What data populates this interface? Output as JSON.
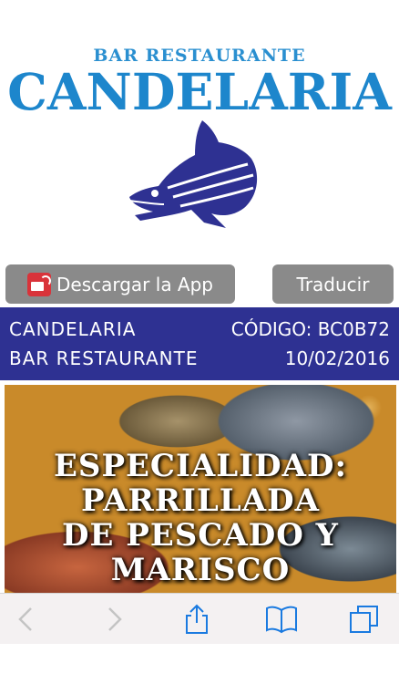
{
  "logo": {
    "subtitle": "BAR RESTAURANTE",
    "title": "CANDELARIA",
    "brand_color": "#1d86cc",
    "fish_color": "#2e3192"
  },
  "buttons": {
    "app_label": "Descargar la App",
    "translate_label": "Traducir"
  },
  "info_bar": {
    "name": "CANDELARIA",
    "type": "BAR RESTAURANTE",
    "code": "CÓDIGO: BC0B72",
    "date": "10/02/2016",
    "bg_color": "#2e3192"
  },
  "banner": {
    "line1": "ESPECIALIDAD:",
    "line2": "PARRILLADA",
    "line3": "DE PESCADO Y",
    "line4": "MARISCO"
  },
  "toolbar": {
    "icons": [
      "back-icon",
      "forward-icon",
      "share-icon",
      "bookmarks-icon",
      "tabs-icon"
    ],
    "accent": "#1a7ae0"
  }
}
